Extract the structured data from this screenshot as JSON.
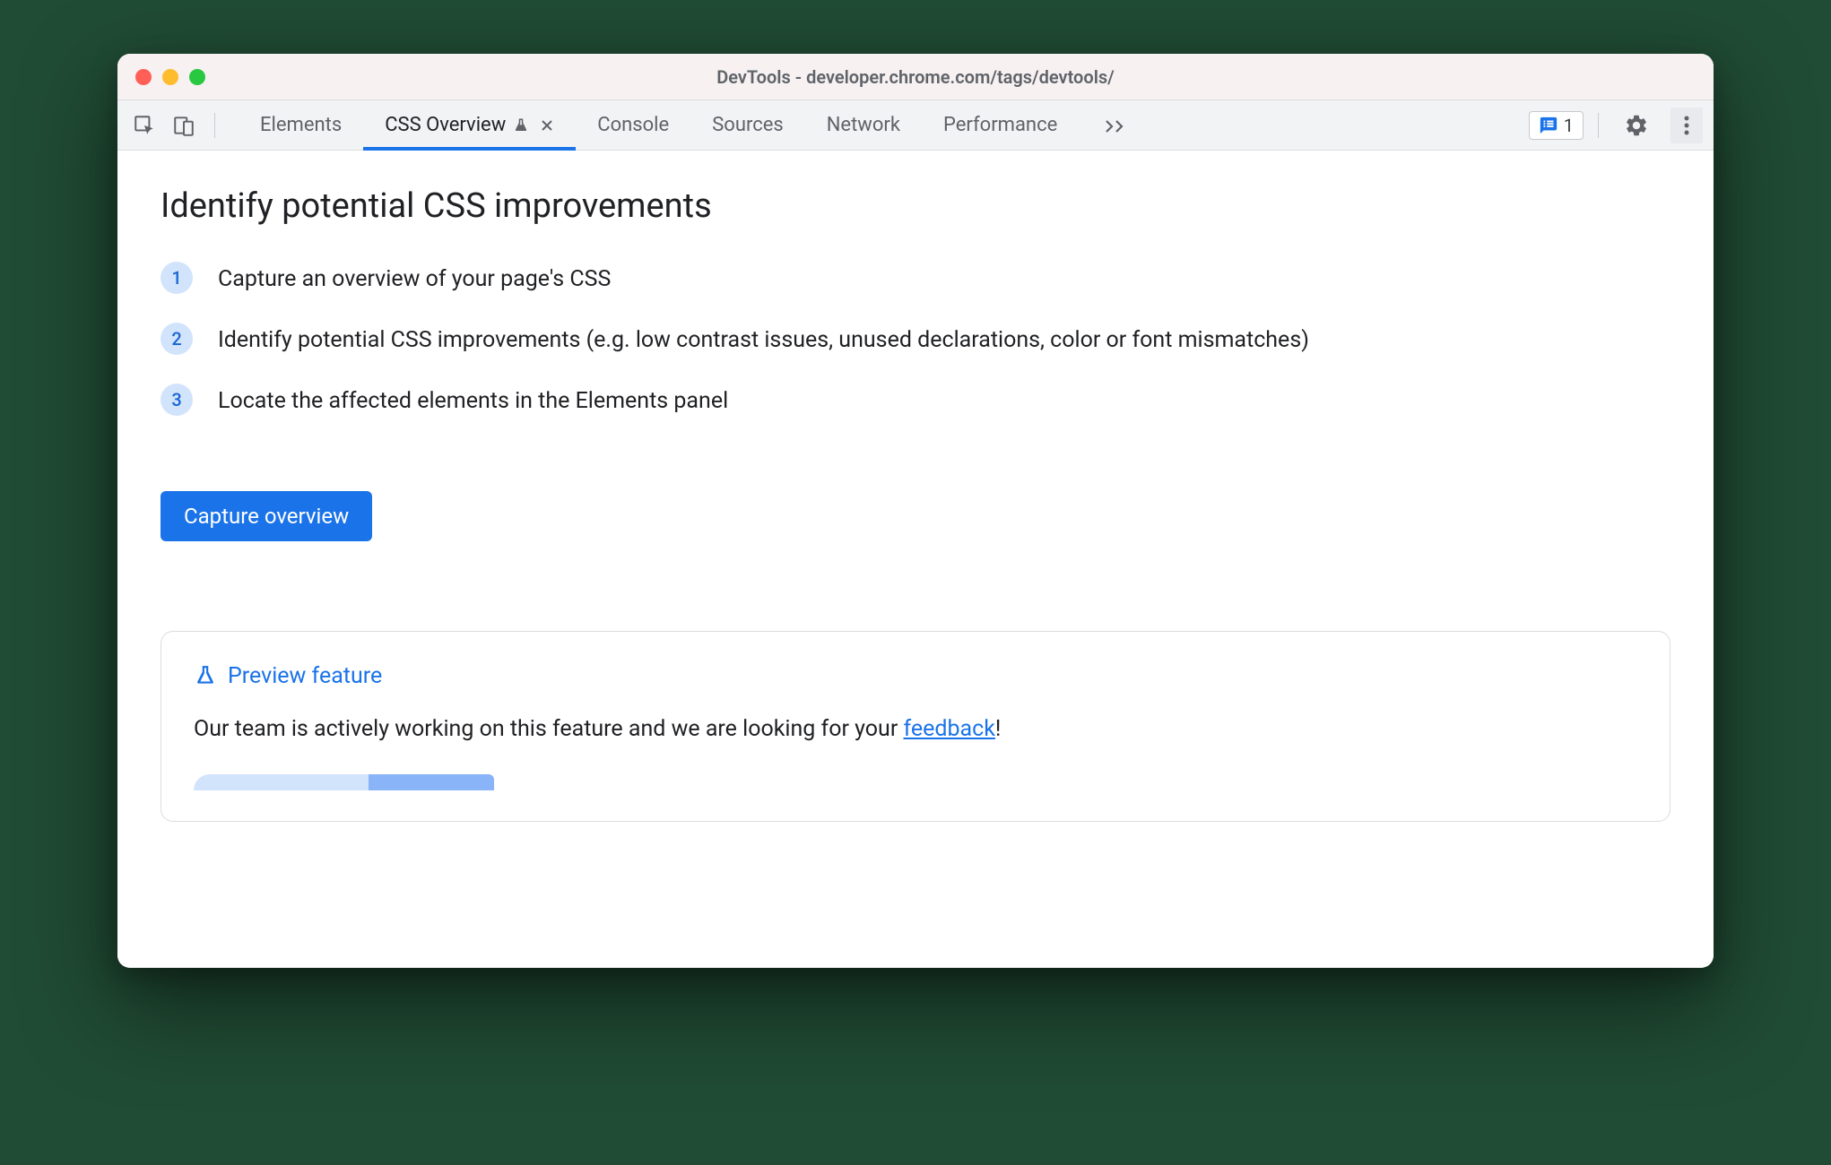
{
  "window_title": "DevTools - developer.chrome.com/tags/devtools/",
  "tabs": [
    {
      "label": "Elements",
      "active": false,
      "experimental": false,
      "closeable": false
    },
    {
      "label": "CSS Overview",
      "active": true,
      "experimental": true,
      "closeable": true
    },
    {
      "label": "Console",
      "active": false,
      "experimental": false,
      "closeable": false
    },
    {
      "label": "Sources",
      "active": false,
      "experimental": false,
      "closeable": false
    },
    {
      "label": "Network",
      "active": false,
      "experimental": false,
      "closeable": false
    },
    {
      "label": "Performance",
      "active": false,
      "experimental": false,
      "closeable": false
    }
  ],
  "issues_count": "1",
  "main": {
    "heading": "Identify potential CSS improvements",
    "steps": [
      "Capture an overview of your page's CSS",
      "Identify potential CSS improvements (e.g. low contrast issues, unused declarations, color or font mismatches)",
      "Locate the affected elements in the Elements panel"
    ],
    "capture_button": "Capture overview"
  },
  "preview": {
    "title": "Preview feature",
    "text_before": "Our team is actively working on this feature and we are looking for your ",
    "link_text": "feedback",
    "text_after": "!"
  }
}
